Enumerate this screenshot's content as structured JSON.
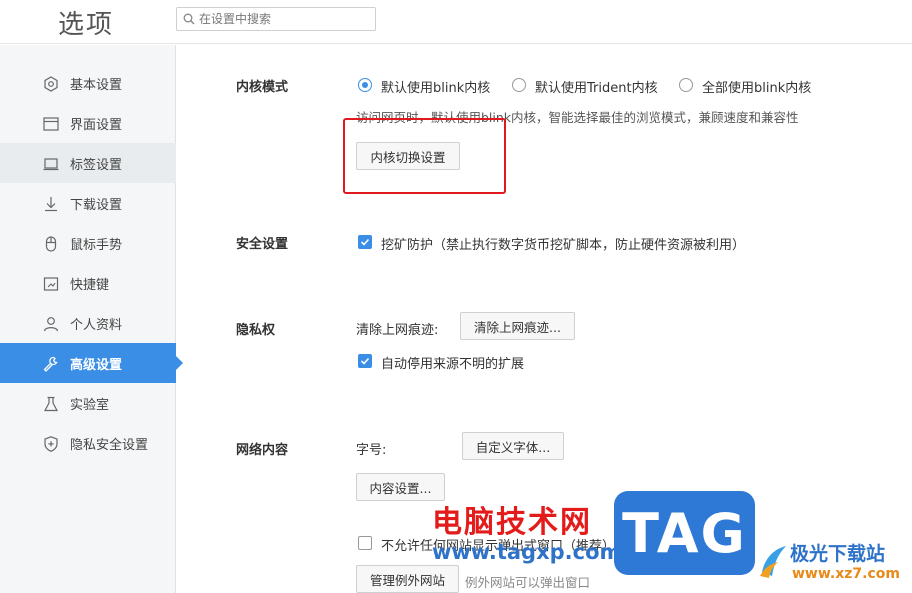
{
  "app": {
    "title": "选项"
  },
  "search": {
    "placeholder": "在设置中搜索"
  },
  "sidebar": {
    "items": [
      {
        "label": "基本设置",
        "icon": "hexagon-settings-icon"
      },
      {
        "label": "界面设置",
        "icon": "window-icon"
      },
      {
        "label": "标签设置",
        "icon": "tab-icon"
      },
      {
        "label": "下载设置",
        "icon": "download-icon"
      },
      {
        "label": "鼠标手势",
        "icon": "mouse-icon"
      },
      {
        "label": "快捷键",
        "icon": "shortcut-icon"
      },
      {
        "label": "个人资料",
        "icon": "person-icon"
      },
      {
        "label": "高级设置",
        "icon": "wrench-icon",
        "active": true
      },
      {
        "label": "实验室",
        "icon": "flask-icon"
      },
      {
        "label": "隐私安全设置",
        "icon": "shield-icon"
      }
    ]
  },
  "kernel": {
    "label": "内核模式",
    "options": [
      "默认使用blink内核",
      "默认使用Trident内核",
      "全部使用blink内核"
    ],
    "selected_index": 0,
    "description": "访问网页时，默认使用blink内核，智能选择最佳的浏览模式，兼顾速度和兼容性",
    "switch_button": "内核切换设置"
  },
  "security": {
    "label": "安全设置",
    "mining_protection": "挖矿防护（禁止执行数字货币挖矿脚本，防止硬件资源被利用）",
    "mining_checked": true
  },
  "privacy": {
    "label": "隐私权",
    "clear_label": "清除上网痕迹:",
    "clear_button": "清除上网痕迹...",
    "auto_disable": "自动停用来源不明的扩展",
    "auto_disable_checked": true
  },
  "web_content": {
    "label": "网络内容",
    "font_label": "字号:",
    "custom_font_button": "自定义字体...",
    "content_settings_button": "内容设置...",
    "block_popups": "不允许任何网站显示弹出式窗口（推荐）",
    "block_popups_checked": false,
    "manage_exceptions_button": "管理例外网站",
    "exceptions_note": "例外网站可以弹出窗口"
  },
  "watermark": {
    "name": "电脑技术网",
    "url": "www.tagxp.com",
    "tag": "TAG",
    "brand": "极光下载站",
    "brand_url": "www.xz7.com"
  },
  "colors": {
    "accent": "#3a8ee6",
    "highlight": "#e0181f",
    "sidebar_bg": "#f5f6f7"
  }
}
